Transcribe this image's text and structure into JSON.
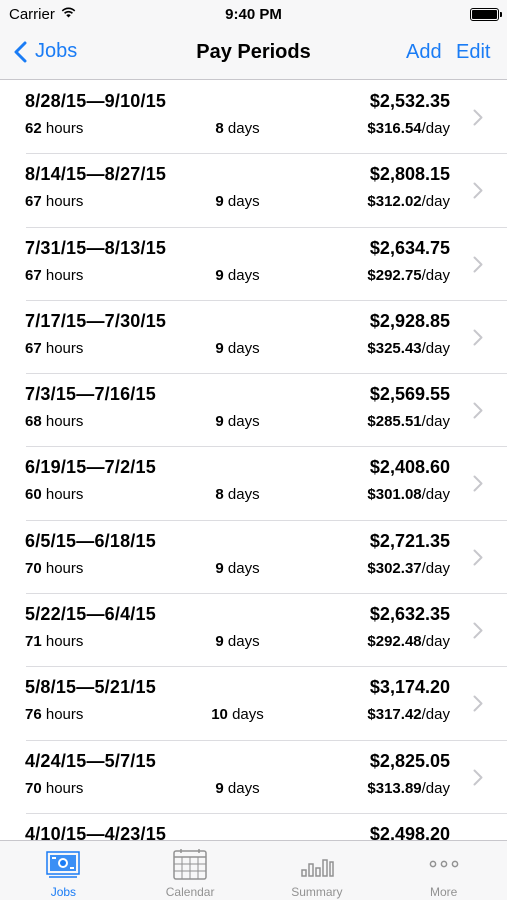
{
  "status": {
    "carrier": "Carrier",
    "time": "9:40 PM"
  },
  "nav": {
    "back_label": "Jobs",
    "title": "Pay Periods",
    "add_label": "Add",
    "edit_label": "Edit"
  },
  "periods": [
    {
      "range": "8/28/15—9/10/15",
      "total": "$2,532.35",
      "hours_num": "62",
      "hours_unit": " hours",
      "days_num": "8",
      "days_unit": " days",
      "rate_num": "$316.54",
      "rate_unit": "/day"
    },
    {
      "range": "8/14/15—8/27/15",
      "total": "$2,808.15",
      "hours_num": "67",
      "hours_unit": " hours",
      "days_num": "9",
      "days_unit": " days",
      "rate_num": "$312.02",
      "rate_unit": "/day"
    },
    {
      "range": "7/31/15—8/13/15",
      "total": "$2,634.75",
      "hours_num": "67",
      "hours_unit": " hours",
      "days_num": "9",
      "days_unit": " days",
      "rate_num": "$292.75",
      "rate_unit": "/day"
    },
    {
      "range": "7/17/15—7/30/15",
      "total": "$2,928.85",
      "hours_num": "67",
      "hours_unit": " hours",
      "days_num": "9",
      "days_unit": " days",
      "rate_num": "$325.43",
      "rate_unit": "/day"
    },
    {
      "range": "7/3/15—7/16/15",
      "total": "$2,569.55",
      "hours_num": "68",
      "hours_unit": " hours",
      "days_num": "9",
      "days_unit": " days",
      "rate_num": "$285.51",
      "rate_unit": "/day"
    },
    {
      "range": "6/19/15—7/2/15",
      "total": "$2,408.60",
      "hours_num": "60",
      "hours_unit": " hours",
      "days_num": "8",
      "days_unit": " days",
      "rate_num": "$301.08",
      "rate_unit": "/day"
    },
    {
      "range": "6/5/15—6/18/15",
      "total": "$2,721.35",
      "hours_num": "70",
      "hours_unit": " hours",
      "days_num": "9",
      "days_unit": " days",
      "rate_num": "$302.37",
      "rate_unit": "/day"
    },
    {
      "range": "5/22/15—6/4/15",
      "total": "$2,632.35",
      "hours_num": "71",
      "hours_unit": " hours",
      "days_num": "9",
      "days_unit": " days",
      "rate_num": "$292.48",
      "rate_unit": "/day"
    },
    {
      "range": "5/8/15—5/21/15",
      "total": "$3,174.20",
      "hours_num": "76",
      "hours_unit": " hours",
      "days_num": "10",
      "days_unit": " days",
      "rate_num": "$317.42",
      "rate_unit": "/day"
    },
    {
      "range": "4/24/15—5/7/15",
      "total": "$2,825.05",
      "hours_num": "70",
      "hours_unit": " hours",
      "days_num": "9",
      "days_unit": " days",
      "rate_num": "$313.89",
      "rate_unit": "/day"
    },
    {
      "range": "4/10/15—4/23/15",
      "total": "$2,498.20",
      "hours_num": "",
      "hours_unit": "",
      "days_num": "",
      "days_unit": "",
      "rate_num": "",
      "rate_unit": ""
    }
  ],
  "tabs": [
    {
      "label": "Jobs",
      "icon": "jobs-money-icon",
      "active": true
    },
    {
      "label": "Calendar",
      "icon": "calendar-icon",
      "active": false
    },
    {
      "label": "Summary",
      "icon": "bar-chart-icon",
      "active": false
    },
    {
      "label": "More",
      "icon": "more-dots-icon",
      "active": false
    }
  ],
  "colors": {
    "accent": "#1a7cf5",
    "inactive_tab": "#929292",
    "separator": "#dcdce0",
    "bar_background": "#f7f7f8"
  }
}
